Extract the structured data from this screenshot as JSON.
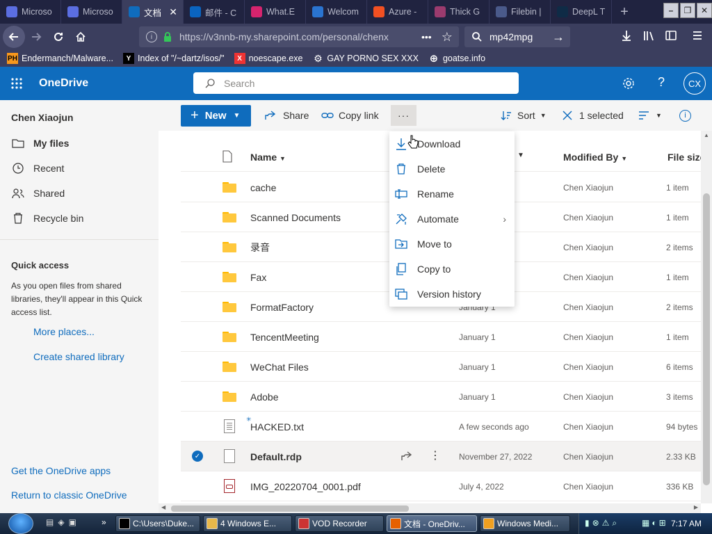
{
  "browser": {
    "tabs": [
      {
        "title": "Microso",
        "color": "#5b6ee1"
      },
      {
        "title": "Microso",
        "color": "#5b6ee1"
      },
      {
        "title": "文档",
        "color": "#0f6cbd",
        "active": true
      },
      {
        "title": "邮件 - C",
        "color": "#0a64c0"
      },
      {
        "title": "What.E",
        "color": "#d6246e"
      },
      {
        "title": "Welcom",
        "color": "#2a74d0"
      },
      {
        "title": "Azure -",
        "color": "#f25022"
      },
      {
        "title": "Thick G",
        "color": "#9b3b6e"
      },
      {
        "title": "Filebin |",
        "color": "#4a5a8a"
      },
      {
        "title": "DeepL T",
        "color": "#0f2b46"
      }
    ],
    "url": "https://v3nnb-my.sharepoint.com/personal/chenx",
    "search_value": "mp42mpg",
    "bookmarks": [
      {
        "label": "Endermanch/Malware...",
        "icon": "PH"
      },
      {
        "label": "Index of \"/~dartz/isos/\"",
        "icon": "Y"
      },
      {
        "label": "noescape.exe",
        "icon": "X"
      },
      {
        "label": "GAY PORNO SEX XXX",
        "icon": "gear"
      },
      {
        "label": "goatse.info",
        "icon": "globe"
      }
    ]
  },
  "onedrive": {
    "app_name": "OneDrive",
    "search_placeholder": "Search",
    "avatar": "CX",
    "user_name": "Chen Xiaojun",
    "nav": [
      {
        "label": "My files",
        "icon": "folder-icon",
        "active": true
      },
      {
        "label": "Recent",
        "icon": "clock-icon"
      },
      {
        "label": "Shared",
        "icon": "people-icon"
      },
      {
        "label": "Recycle bin",
        "icon": "trash-icon"
      }
    ],
    "quick_access": {
      "title": "Quick access",
      "description": "As you open files from shared libraries, they'll appear in this Quick access list.",
      "more_places": "More places...",
      "create_library": "Create shared library"
    },
    "get_apps": "Get the OneDrive apps",
    "return_classic": "Return to classic OneDrive",
    "toolbar": {
      "new_label": "New",
      "share_label": "Share",
      "copy_link_label": "Copy link",
      "more_label": "···",
      "sort_label": "Sort",
      "selected_label": "1 selected"
    },
    "columns": {
      "name": "Name",
      "modified_by": "Modified By",
      "file_size": "File size"
    },
    "files": [
      {
        "name": "cache",
        "type": "folder",
        "modified": "",
        "by": "Chen Xiaojun",
        "size": "1 item"
      },
      {
        "name": "Scanned Documents",
        "type": "folder",
        "modified": "",
        "by": "Chen Xiaojun",
        "size": "1 item"
      },
      {
        "name": "录音",
        "type": "folder",
        "modified": "",
        "by": "Chen Xiaojun",
        "size": "2 items"
      },
      {
        "name": "Fax",
        "type": "folder",
        "modified": "",
        "by": "Chen Xiaojun",
        "size": "1 item"
      },
      {
        "name": "FormatFactory",
        "type": "folder",
        "modified": "January 1",
        "by": "Chen Xiaojun",
        "size": "2 items"
      },
      {
        "name": "TencentMeeting",
        "type": "folder",
        "modified": "January 1",
        "by": "Chen Xiaojun",
        "size": "1 item"
      },
      {
        "name": "WeChat Files",
        "type": "folder",
        "modified": "January 1",
        "by": "Chen Xiaojun",
        "size": "6 items"
      },
      {
        "name": "Adobe",
        "type": "folder",
        "modified": "January 1",
        "by": "Chen Xiaojun",
        "size": "3 items"
      },
      {
        "name": "HACKED.txt",
        "type": "txt",
        "modified": "A few seconds ago",
        "by": "Chen Xiaojun",
        "size": "94 bytes"
      },
      {
        "name": "Default.rdp",
        "type": "rdp",
        "modified": "November 27, 2022",
        "by": "Chen Xiaojun",
        "size": "2.33 KB",
        "selected": true
      },
      {
        "name": "IMG_20220704_0001.pdf",
        "type": "pdf",
        "modified": "July 4, 2022",
        "by": "Chen Xiaojun",
        "size": "336 KB"
      }
    ],
    "menu": [
      {
        "label": "Download",
        "icon": "download-icon"
      },
      {
        "label": "Delete",
        "icon": "trash-icon"
      },
      {
        "label": "Rename",
        "icon": "rename-icon"
      },
      {
        "label": "Automate",
        "icon": "automate-icon",
        "submenu": true
      },
      {
        "label": "Move to",
        "icon": "move-icon"
      },
      {
        "label": "Copy to",
        "icon": "copy-icon"
      },
      {
        "label": "Version history",
        "icon": "history-icon"
      }
    ],
    "accent": "#0f6cbd"
  },
  "taskbar": {
    "items": [
      {
        "label": "C:\\Users\\Duke...",
        "color": "#000"
      },
      {
        "label": "4 Windows E...",
        "color": "#e8b84a"
      },
      {
        "label": "VOD Recorder",
        "color": "#c33"
      },
      {
        "label": "文档 - OneDriv...",
        "color": "#e66000",
        "active": true
      },
      {
        "label": "Windows Medi...",
        "color": "#f0a020"
      }
    ],
    "clock": "7:17 AM"
  }
}
